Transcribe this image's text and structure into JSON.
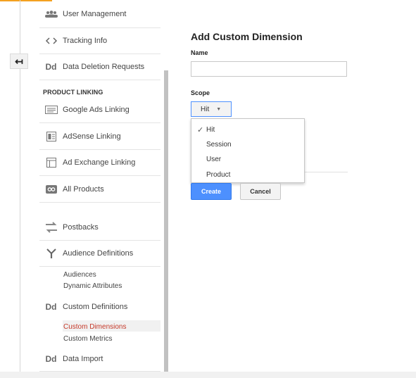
{
  "theme": {
    "accent": "#f4a120",
    "link_active": "#c53929",
    "primary_button": "#4d90fe"
  },
  "back_button": {
    "icon": "back-arrow-icon",
    "glyph": "↤"
  },
  "sidebar": {
    "items_top": [
      {
        "label": "User Management",
        "icon": "users-icon"
      },
      {
        "label": "Tracking Info",
        "icon": "code-brackets-icon"
      },
      {
        "label": "Data Deletion Requests",
        "icon": "dd-icon",
        "glyph": "Dd"
      }
    ],
    "section_product_linking": "PRODUCT LINKING",
    "items_linking": [
      {
        "label": "Google Ads Linking",
        "icon": "google-ads-icon"
      },
      {
        "label": "AdSense Linking",
        "icon": "adsense-icon"
      },
      {
        "label": "Ad Exchange Linking",
        "icon": "ad-exchange-icon"
      },
      {
        "label": "All Products",
        "icon": "link-icon"
      }
    ],
    "items_other": [
      {
        "label": "Postbacks",
        "icon": "postbacks-icon"
      },
      {
        "label": "Audience Definitions",
        "icon": "audience-fork-icon"
      }
    ],
    "audience_sub": [
      "Audiences",
      "Dynamic Attributes"
    ],
    "custom_definitions": {
      "label": "Custom Definitions",
      "glyph": "Dd"
    },
    "custom_sub": [
      "Custom Dimensions",
      "Custom Metrics"
    ],
    "data_import": {
      "label": "Data Import",
      "glyph": "Dd"
    }
  },
  "main": {
    "title": "Add Custom Dimension",
    "name_label": "Name",
    "name_value": "",
    "scope_label": "Scope",
    "scope_selected": "Hit",
    "scope_options": [
      "Hit",
      "Session",
      "User",
      "Product"
    ],
    "create_label": "Create",
    "cancel_label": "Cancel"
  }
}
